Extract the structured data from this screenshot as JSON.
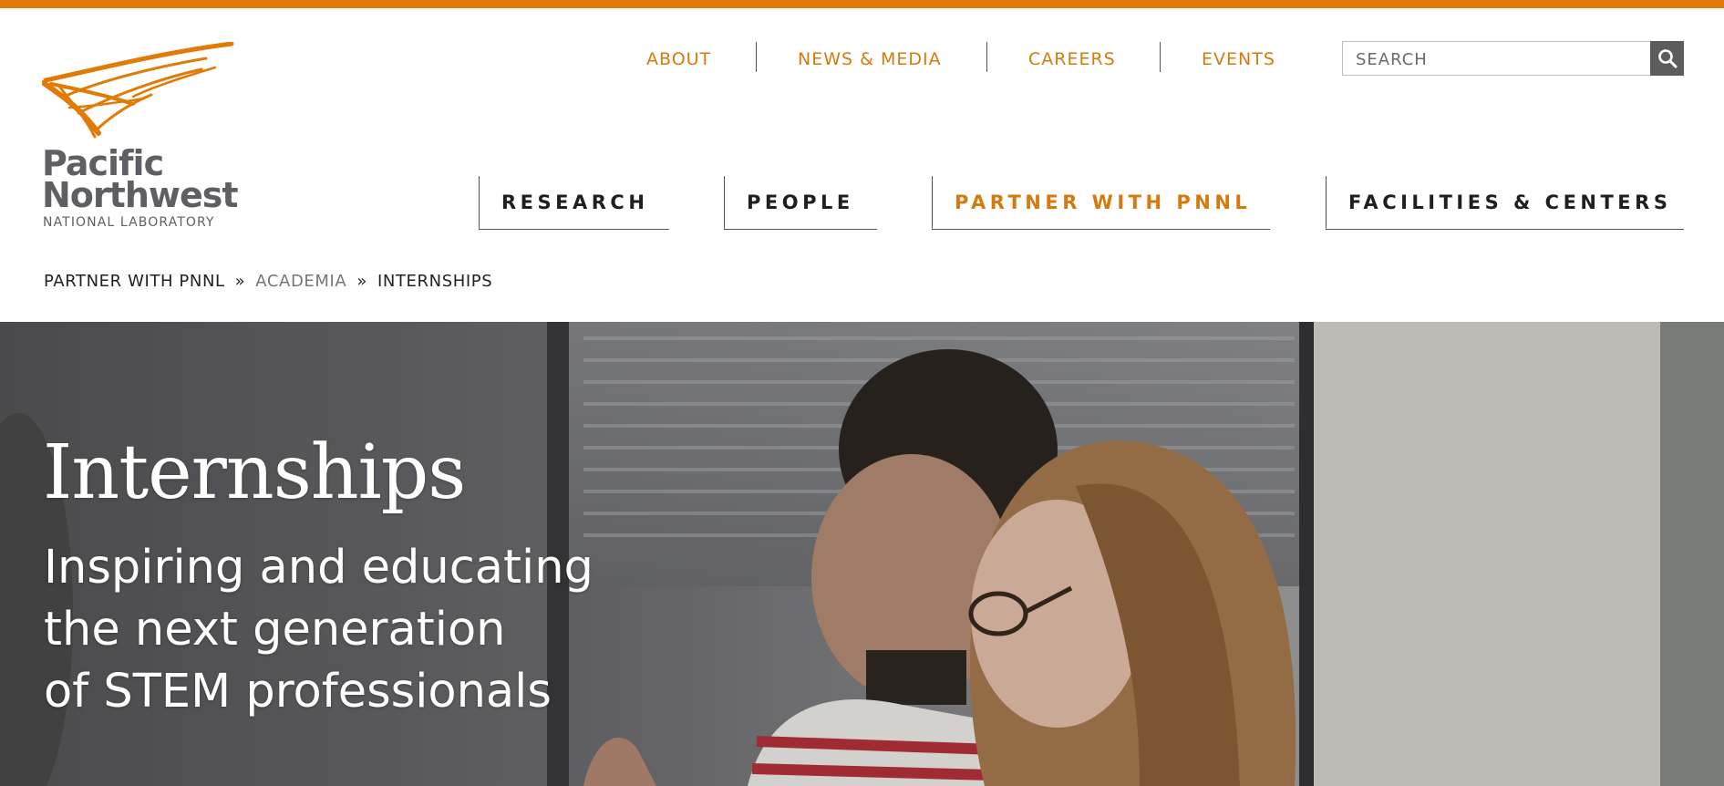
{
  "brand": {
    "logo_line1": "Pacific",
    "logo_line2": "Northwest",
    "logo_line3": "NATIONAL LABORATORY",
    "accent_color": "#e17b06"
  },
  "utility_nav": {
    "items": [
      {
        "label": "ABOUT"
      },
      {
        "label": "NEWS & MEDIA"
      },
      {
        "label": "CAREERS"
      },
      {
        "label": "EVENTS"
      }
    ]
  },
  "search": {
    "placeholder": "SEARCH",
    "icon": "search-icon"
  },
  "main_nav": {
    "items": [
      {
        "label": "RESEARCH",
        "active": false
      },
      {
        "label": "PEOPLE",
        "active": false
      },
      {
        "label": "PARTNER WITH PNNL",
        "active": true
      },
      {
        "label": "FACILITIES & CENTERS",
        "active": false
      }
    ]
  },
  "breadcrumb": {
    "items": [
      "PARTNER WITH PNNL",
      "ACADEMIA",
      "INTERNSHIPS"
    ],
    "separator": "»"
  },
  "hero": {
    "title": "Internships",
    "subtitle_lines": [
      "Inspiring and educating",
      "the next generation",
      "of STEM professionals"
    ]
  }
}
